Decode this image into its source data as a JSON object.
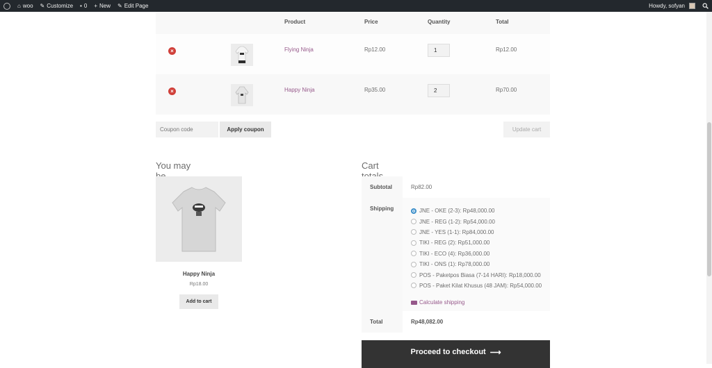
{
  "adminbar": {
    "site_name": "woo",
    "customize": "Customize",
    "comments": "0",
    "new": "New",
    "edit_page": "Edit Page",
    "howdy": "Howdy, sofyan"
  },
  "cart": {
    "headers": [
      "Product",
      "Price",
      "Quantity",
      "Total"
    ],
    "items": [
      {
        "name": "Flying Ninja",
        "price": "Rp12.00",
        "qty": "1",
        "total": "Rp12.00"
      },
      {
        "name": "Happy Ninja",
        "price": "Rp35.00",
        "qty": "2",
        "total": "Rp70.00"
      }
    ],
    "coupon_placeholder": "Coupon code",
    "apply_coupon": "Apply coupon",
    "update_cart": "Update cart"
  },
  "crosssells": {
    "title": "You may be interested in…",
    "product": {
      "name": "Happy Ninja",
      "price": "Rp18.00",
      "button": "Add to cart"
    }
  },
  "totals": {
    "title": "Cart totals",
    "subtotal_label": "Subtotal",
    "subtotal": "Rp82.00",
    "shipping_label": "Shipping",
    "shipping_options": [
      "JNE - OKE (2-3): Rp48,000.00",
      "JNE - REG (1-2): Rp54,000.00",
      "JNE - YES (1-1): Rp84,000.00",
      "TIKI - REG (2): Rp51,000.00",
      "TIKI - ECO (4): Rp36,000.00",
      "TIKI - ONS (1): Rp78,000.00",
      "POS - Paketpos Biasa (7-14 HARI): Rp18,000.00",
      "POS - Paket Kilat Khusus (48 JAM): Rp54,000.00"
    ],
    "selected_index": 0,
    "calculate_shipping": "Calculate shipping",
    "total_label": "Total",
    "total": "Rp48,082.00"
  },
  "checkout": {
    "label": "Proceed to checkout",
    "arrow": "⟶"
  },
  "colors": {
    "accent": "#96588a",
    "remove": "#d0403a",
    "dark": "#333333"
  }
}
